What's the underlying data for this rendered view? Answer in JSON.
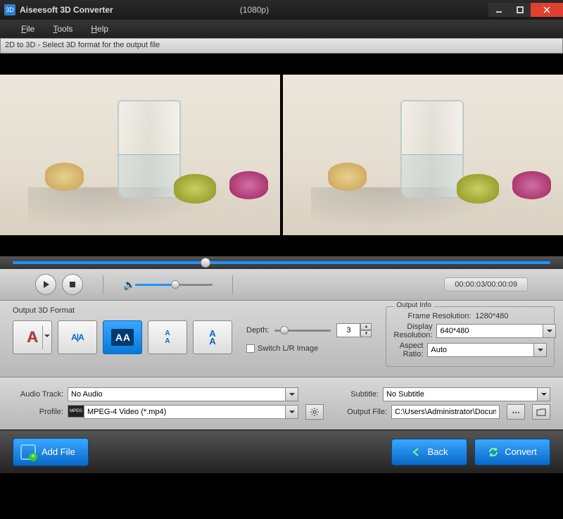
{
  "title": "Aiseesoft 3D Converter",
  "title_suffix": "(1080p)",
  "menu": {
    "file": "File",
    "tools": "Tools",
    "help": "Help"
  },
  "infobar": "2D to 3D - Select 3D format for the output file",
  "playback": {
    "time": "00:00:03/00:00:09"
  },
  "format": {
    "label": "Output 3D Format",
    "depth_label": "Depth:",
    "depth_value": "3",
    "switch_label": "Switch L/R Image",
    "modes": [
      "anaglyph",
      "sbs-half",
      "sbs-full",
      "tb-half",
      "tb-full"
    ],
    "selected": "sbs-full"
  },
  "output_info": {
    "legend": "Output Info",
    "frame_res_label": "Frame Resolution:",
    "frame_res": "1280*480",
    "display_res_label": "Display Resolution:",
    "display_res": "640*480",
    "aspect_label": "Aspect Ratio:",
    "aspect": "Auto"
  },
  "audio": {
    "label": "Audio Track:",
    "value": "No Audio"
  },
  "subtitle": {
    "label": "Subtitle:",
    "value": "No Subtitle"
  },
  "profile": {
    "label": "Profile:",
    "value": "MPEG-4 Video (*.mp4)"
  },
  "output_file": {
    "label": "Output File:",
    "value": "C:\\Users\\Administrator\\Documents\\Aiseesoft Studio"
  },
  "buttons": {
    "add": "Add File",
    "back": "Back",
    "convert": "Convert"
  }
}
